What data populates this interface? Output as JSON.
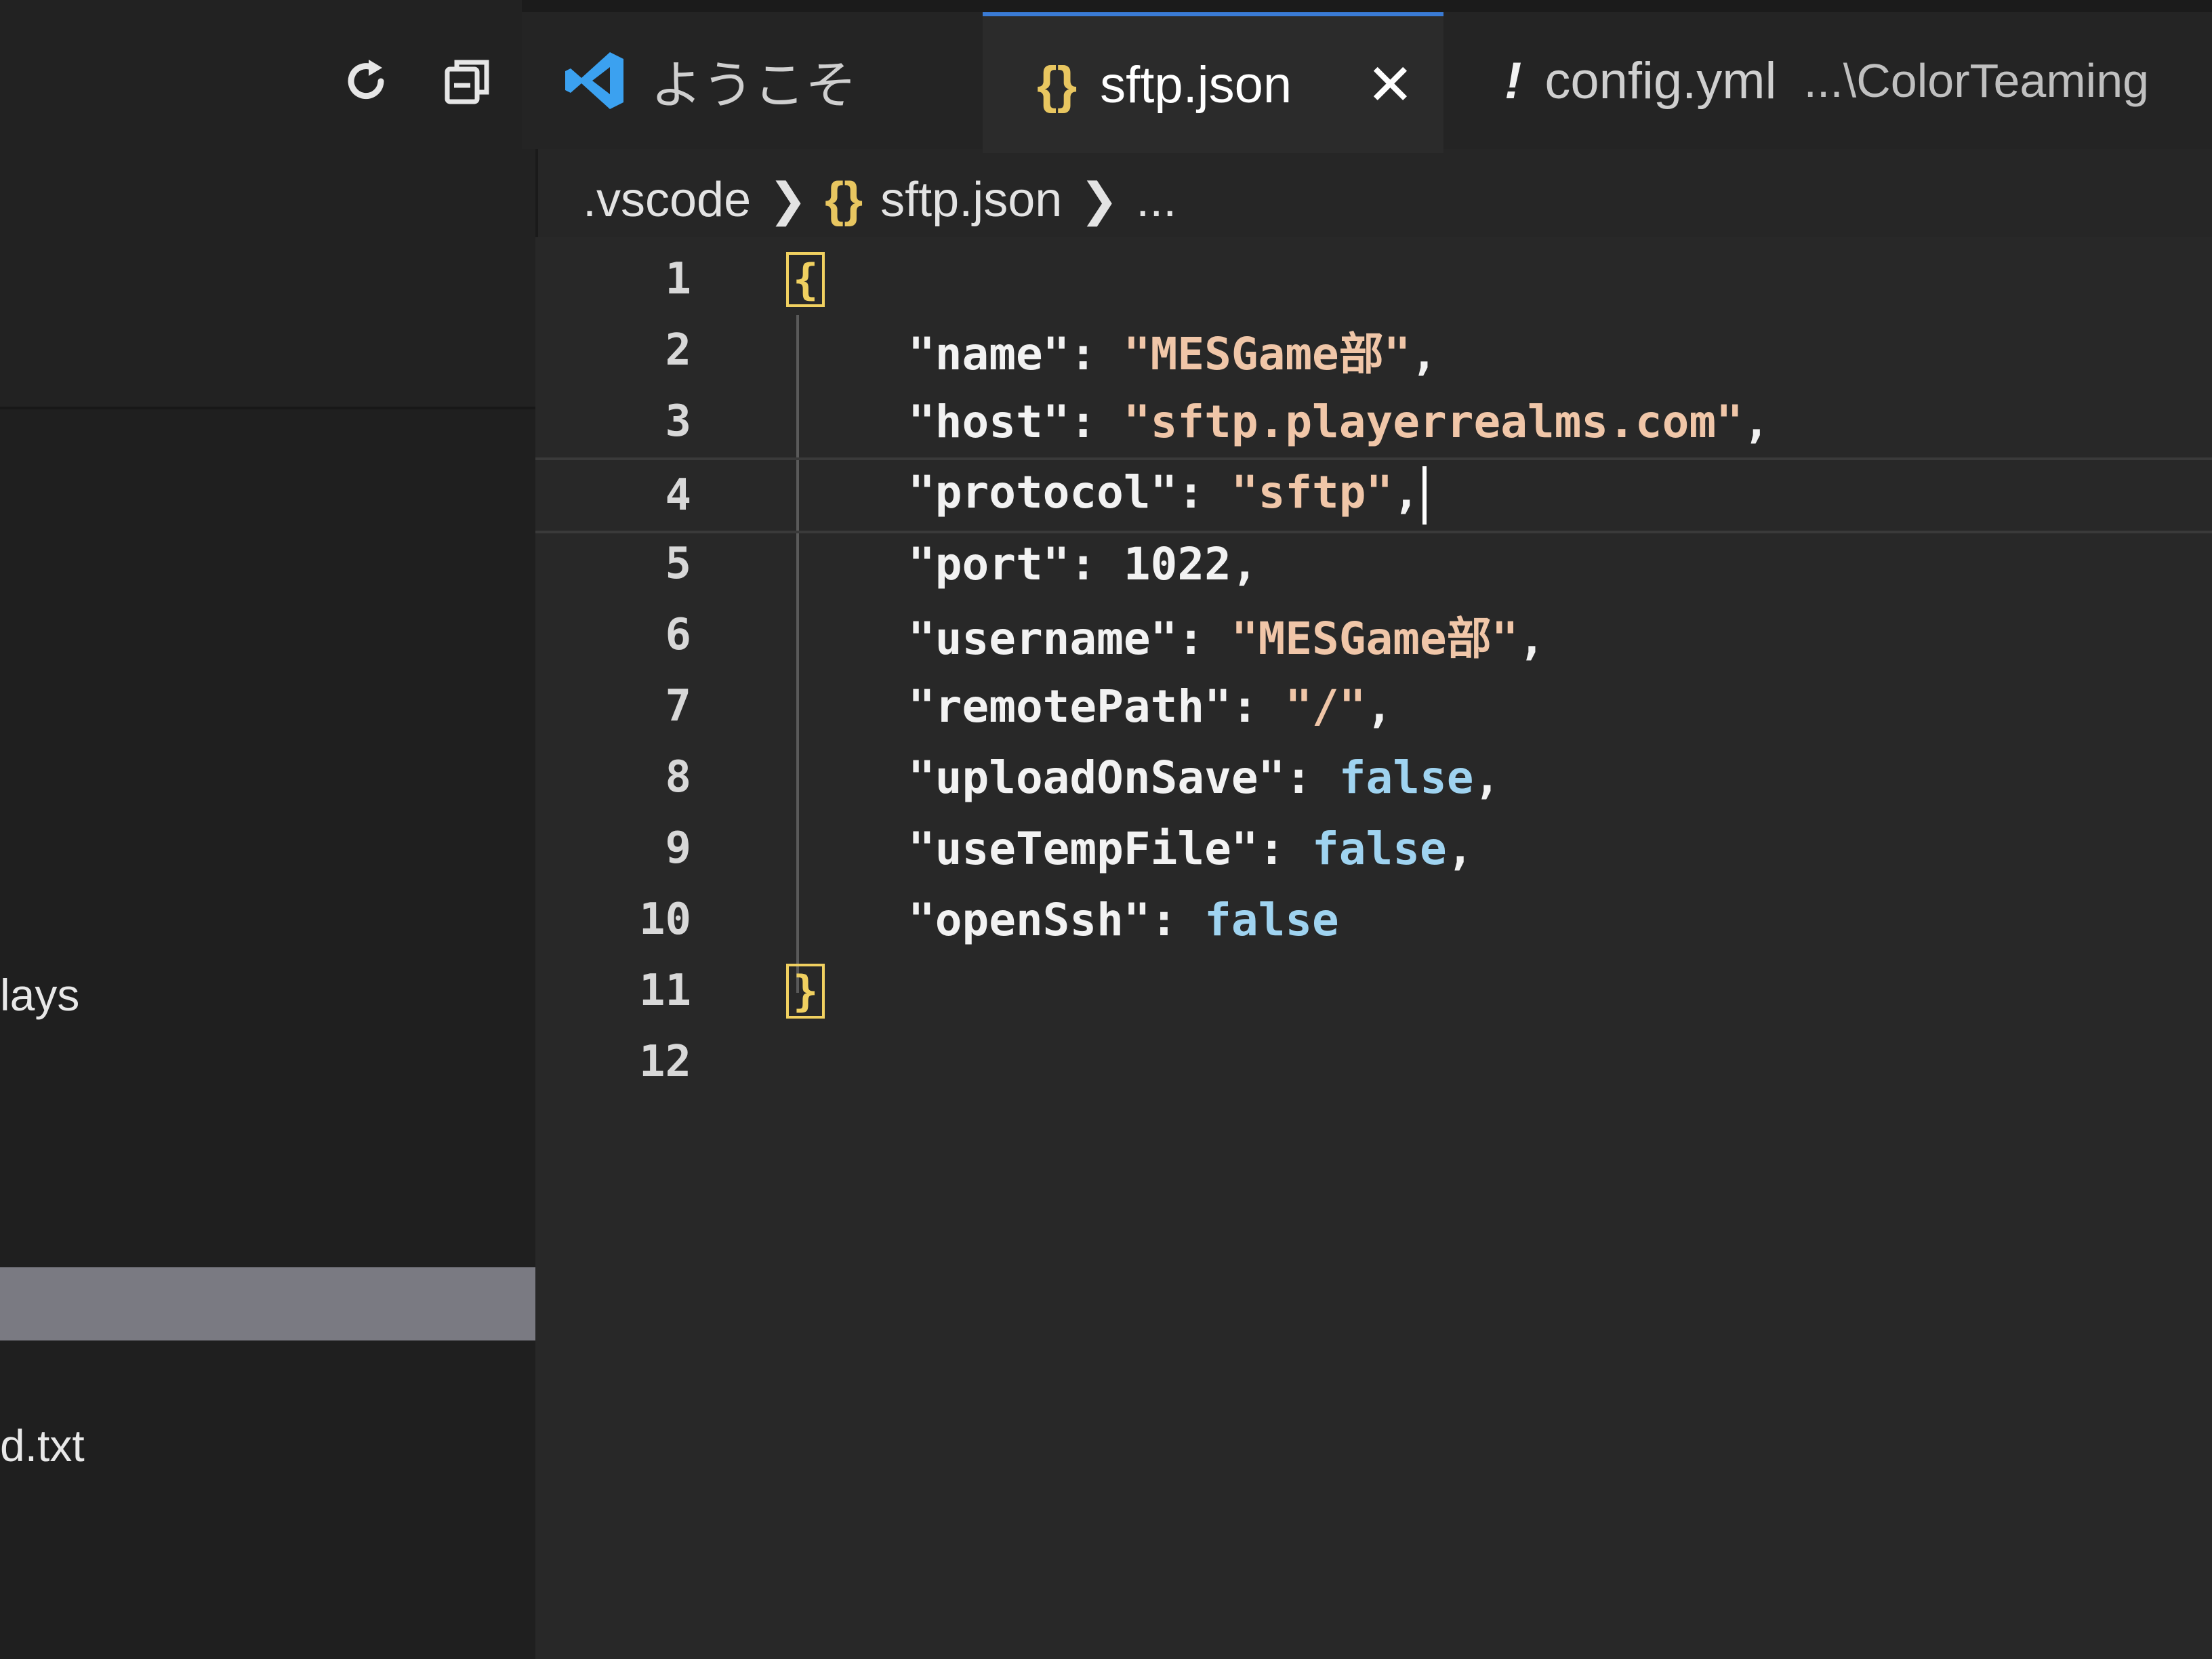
{
  "sidebar": {
    "items": [
      {
        "label": "lays"
      },
      {
        "label": "d.txt"
      }
    ]
  },
  "tabs": [
    {
      "label": "ようこそ",
      "icon": "vscode-logo-icon"
    },
    {
      "label": "sftp.json",
      "icon": "json-braces-icon",
      "icon_text": "{}",
      "active": true
    },
    {
      "label": "config.yml",
      "icon": "exclamation-icon",
      "icon_text": "!",
      "description": "...\\ColorTeaming"
    }
  ],
  "breadcrumb": {
    "folder": ".vscode",
    "file_icon": "{}",
    "file": "sftp.json",
    "ellipsis": "..."
  },
  "editor": {
    "lines": [
      {
        "n": "1",
        "open_brace": "{"
      },
      {
        "n": "2",
        "key": "\"name\"",
        "colon": ": ",
        "value": "\"MESGame部\"",
        "vtype": "s",
        "trail": ","
      },
      {
        "n": "3",
        "key": "\"host\"",
        "colon": ": ",
        "value": "\"sftp.playerrealms.com\"",
        "vtype": "s",
        "trail": ","
      },
      {
        "n": "4",
        "key": "\"protocol\"",
        "colon": ": ",
        "value": "\"sftp\"",
        "vtype": "s",
        "trail": ","
      },
      {
        "n": "5",
        "key": "\"port\"",
        "colon": ": ",
        "value": "1022",
        "vtype": "n",
        "trail": ","
      },
      {
        "n": "6",
        "key": "\"username\"",
        "colon": ": ",
        "value": "\"MESGame部\"",
        "vtype": "s",
        "trail": ","
      },
      {
        "n": "7",
        "key": "\"remotePath\"",
        "colon": ": ",
        "value": "\"/\"",
        "vtype": "s",
        "trail": ","
      },
      {
        "n": "8",
        "key": "\"uploadOnSave\"",
        "colon": ": ",
        "value": "false",
        "vtype": "b",
        "trail": ","
      },
      {
        "n": "9",
        "key": "\"useTempFile\"",
        "colon": ": ",
        "value": "false",
        "vtype": "b",
        "trail": ","
      },
      {
        "n": "10",
        "key": "\"openSsh\"",
        "colon": ": ",
        "value": "false",
        "vtype": "b",
        "trail": ""
      },
      {
        "n": "11",
        "close_brace": "}"
      },
      {
        "n": "12"
      }
    ]
  },
  "colors": {
    "string": "#f0c6a8",
    "boolean": "#9fd3f0",
    "bracket_highlight": "#f0d060",
    "active_tab_border": "#3a7bd5"
  }
}
